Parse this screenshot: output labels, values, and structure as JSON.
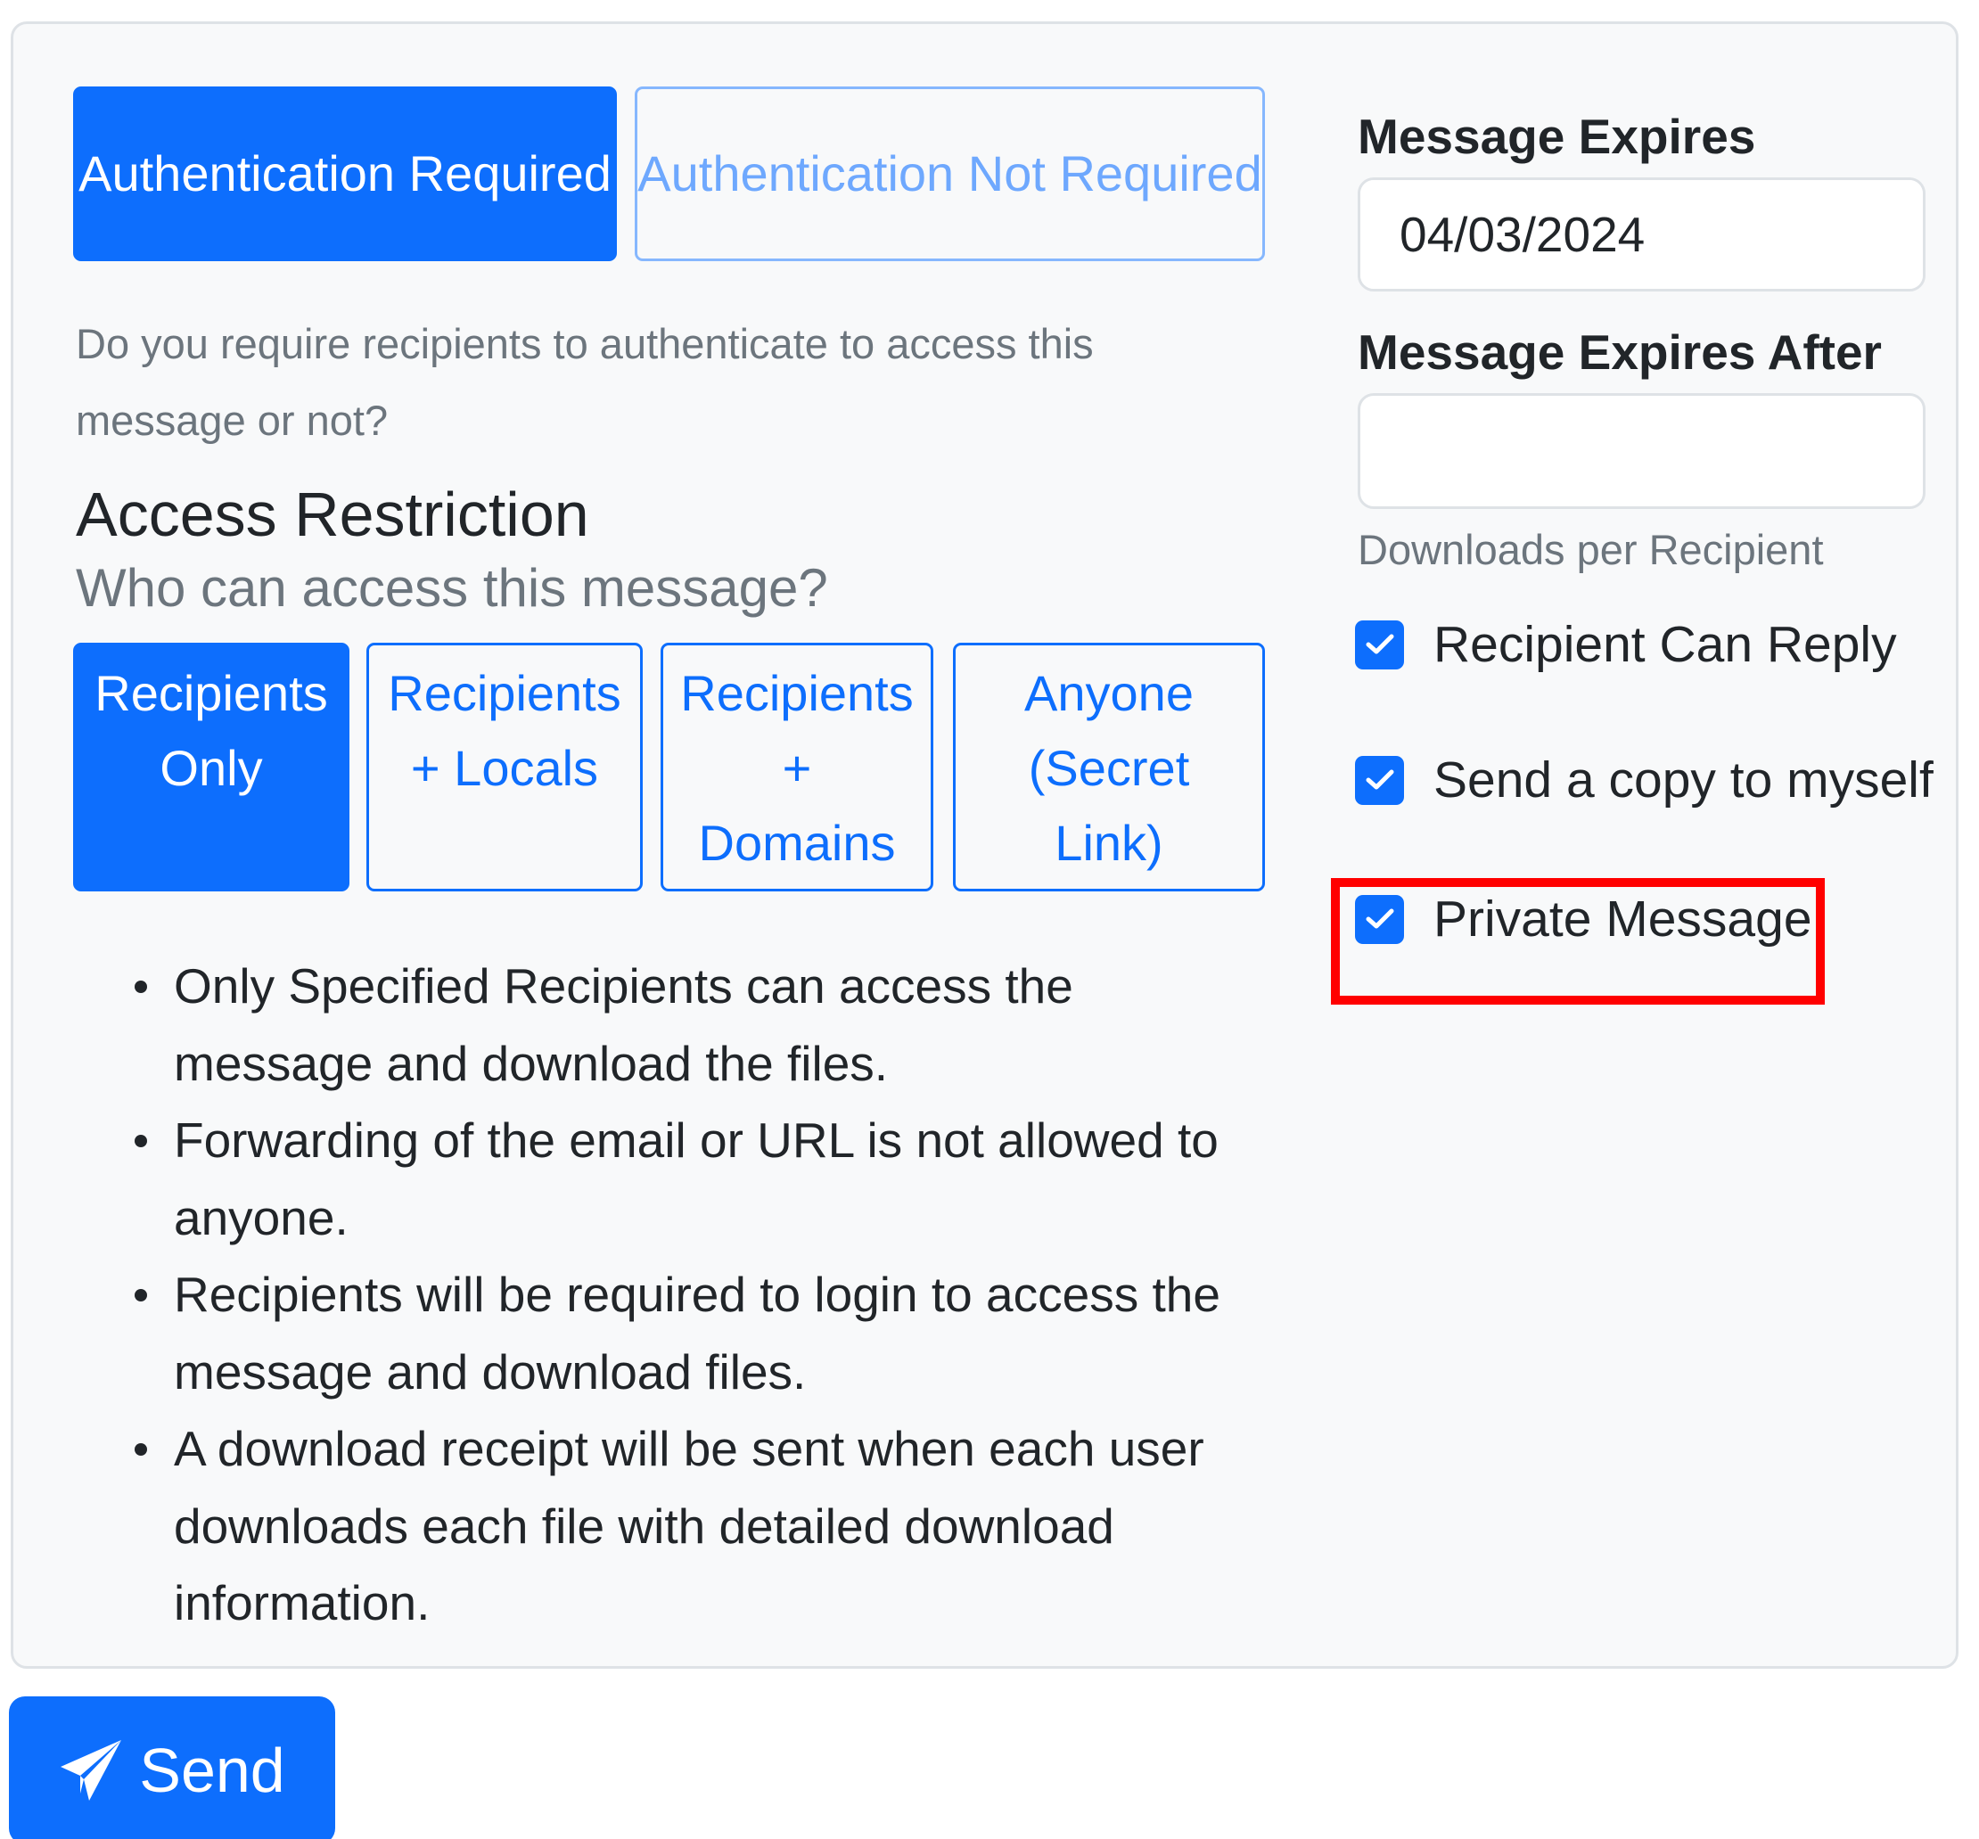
{
  "authentication": {
    "required_label": "Authentication Required",
    "not_required_label": "Authentication Not Required",
    "help": "Do you require recipients to authenticate to access this message or not?"
  },
  "access": {
    "title": "Access Restriction",
    "subtitle": "Who can access this message?",
    "options": [
      {
        "line1": "Recipients",
        "line2": "Only",
        "line3": ""
      },
      {
        "line1": "Recipients",
        "line2": "+ Locals",
        "line3": ""
      },
      {
        "line1": "Recipients",
        "line2": "+",
        "line3": "Domains"
      },
      {
        "line1": "Anyone",
        "line2": "(Secret",
        "line3": "Link)"
      }
    ],
    "bullets": [
      "Only Specified Recipients can access the message and download the files.",
      "Forwarding of the email or URL is not allowed to anyone.",
      "Recipients will be required to login to access the message and download files.",
      "A download receipt will be sent when each user downloads each file with detailed download information."
    ]
  },
  "expires": {
    "label": "Message Expires",
    "date_value": "04/03/2024",
    "after_label": "Message Expires After",
    "after_value": "",
    "after_help": "Downloads per Recipient"
  },
  "options": {
    "reply_label": "Recipient Can Reply",
    "copy_label": "Send a copy to myself",
    "private_label": "Private Message"
  },
  "send_label": "Send",
  "colors": {
    "primary": "#0d6efd",
    "highlight": "#ff0000",
    "panel_bg": "#f8f9fa"
  }
}
